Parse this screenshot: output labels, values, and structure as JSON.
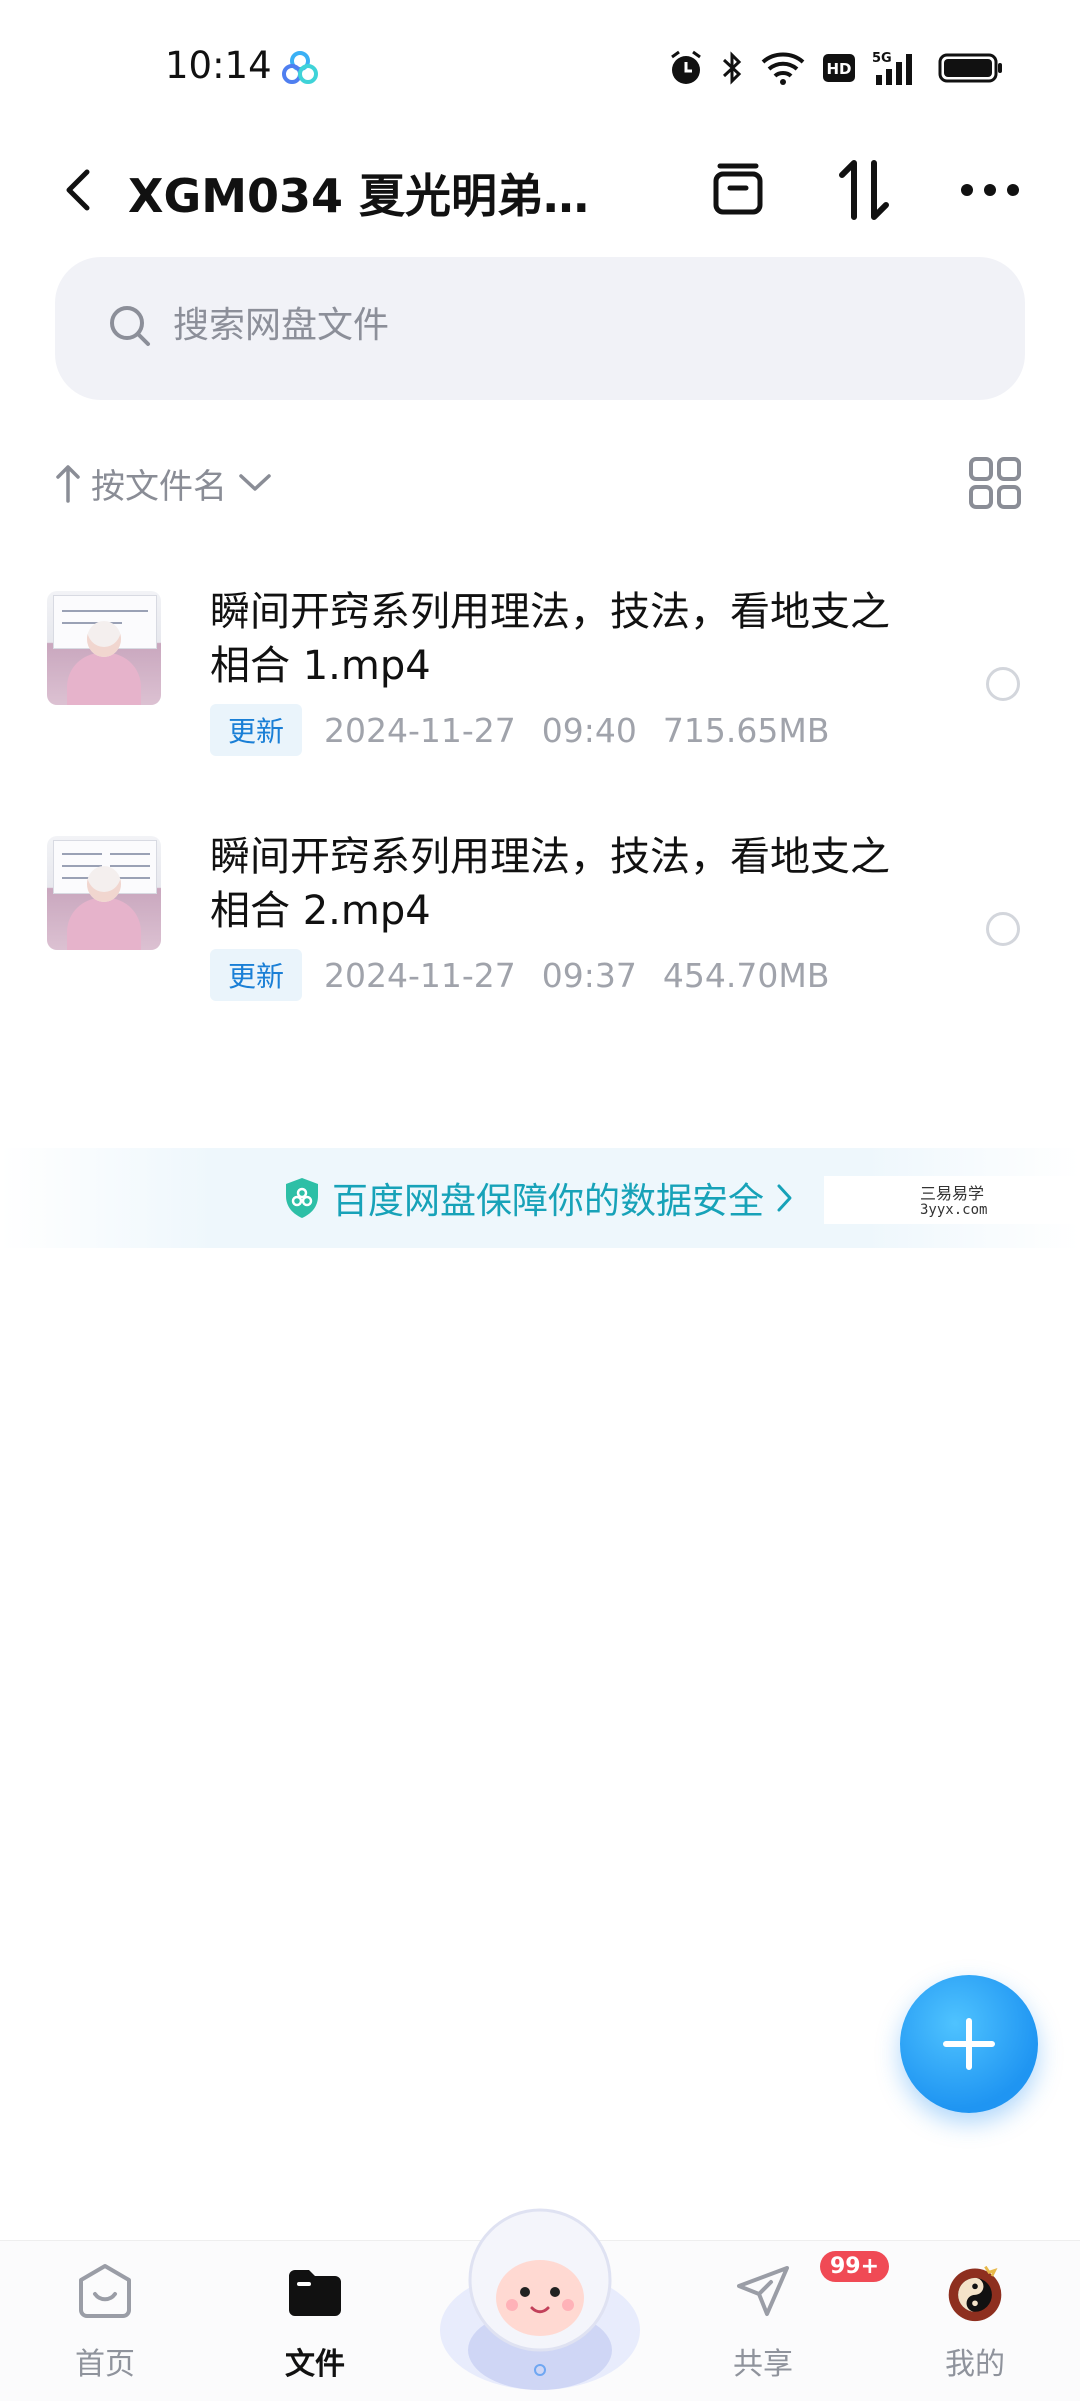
{
  "status_bar": {
    "time": "10:14",
    "app_icon": "baidu-netdisk-icon",
    "icons": [
      "alarm-icon",
      "bluetooth-icon",
      "wifi-icon",
      "hd-icon",
      "signal-5g-icon",
      "battery-icon"
    ]
  },
  "header": {
    "title": "XGM034 夏光明弟子...",
    "actions": [
      "archive-icon",
      "transfer-icon",
      "more-icon"
    ]
  },
  "search": {
    "placeholder": "搜索网盘文件",
    "value": ""
  },
  "sort": {
    "label": "按文件名"
  },
  "files": [
    {
      "name": "瞬间开窍系列用理法，技法，看地支之相合 1.mp4",
      "badge": "更新",
      "date": "2024-11-27",
      "time": "09:40",
      "size": "715.65MB"
    },
    {
      "name": "瞬间开窍系列用理法，技法，看地支之相合 2.mp4",
      "badge": "更新",
      "date": "2024-11-27",
      "time": "09:37",
      "size": "454.70MB"
    }
  ],
  "security_banner": {
    "text": "百度网盘保障你的数据安全"
  },
  "watermark": {
    "title": "三易易学",
    "url": "3yyx.com"
  },
  "bottom_nav": {
    "items": [
      {
        "label": "首页",
        "icon": "home-icon"
      },
      {
        "label": "文件",
        "icon": "folder-icon"
      },
      {
        "label": "共享",
        "icon": "send-icon",
        "badge": "99+"
      },
      {
        "label": "我的",
        "icon": "avatar-icon"
      }
    ]
  },
  "colors": {
    "accent": "#1f95f2",
    "banner_text": "#17a2b8",
    "badge_red": "#f04a55"
  }
}
